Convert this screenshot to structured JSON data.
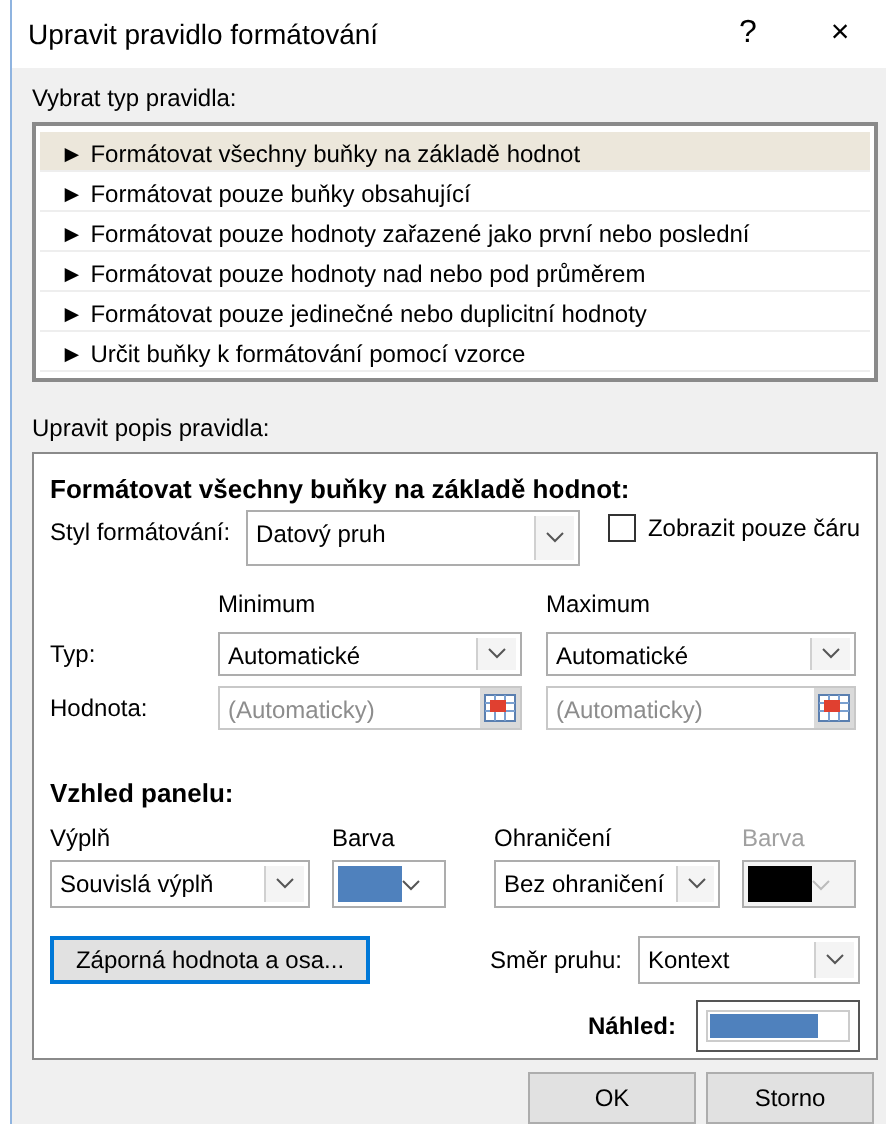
{
  "window": {
    "title": "Upravit pravidlo formátování",
    "help_button": "?",
    "close_button": "×"
  },
  "rule_type": {
    "label": "Vybrat typ pravidla:",
    "items": [
      {
        "text": "► Formátovat všechny buňky na základě hodnot",
        "selected": true
      },
      {
        "text": "► Formátovat pouze buňky obsahující",
        "selected": false
      },
      {
        "text": "► Formátovat pouze hodnoty zařazené jako první nebo poslední",
        "selected": false
      },
      {
        "text": "► Formátovat pouze hodnoty nad nebo pod průměrem",
        "selected": false
      },
      {
        "text": "► Formátovat pouze jedinečné nebo duplicitní hodnoty",
        "selected": false
      },
      {
        "text": "► Určit buňky k formátování pomocí vzorce",
        "selected": false
      }
    ]
  },
  "rule_description": {
    "label": "Upravit popis pravidla:",
    "heading": "Formátovat všechny buňky na základě hodnot:",
    "style": {
      "label": "Styl formátování:",
      "value": "Datový pruh"
    },
    "show_bar_only": {
      "label": "Zobrazit pouze čáru",
      "checked": false
    },
    "columns": [
      "Minimum",
      "Maximum"
    ],
    "type": {
      "label": "Typ:",
      "values": [
        "Automatické",
        "Automatické"
      ]
    },
    "value": {
      "label": "Hodnota:",
      "values": [
        "(Automaticky)",
        "(Automaticky)"
      ],
      "disabled": true
    },
    "appearance": {
      "heading": "Vzhled panelu:",
      "fill": {
        "label": "Výplň",
        "value": "Souvislá výplň"
      },
      "fill_color": {
        "label": "Barva",
        "color": "#4f81bd"
      },
      "border": {
        "label": "Ohraničení",
        "value": "Bez ohraničení"
      },
      "border_color": {
        "label": "Barva",
        "color": "#000000",
        "disabled": true
      }
    },
    "negative_button": "Záporná hodnota a osa...",
    "direction": {
      "label": "Směr pruhu:",
      "value": "Kontext"
    },
    "preview": {
      "label": "Náhled:"
    }
  },
  "buttons": [
    "OK",
    "Storno"
  ]
}
